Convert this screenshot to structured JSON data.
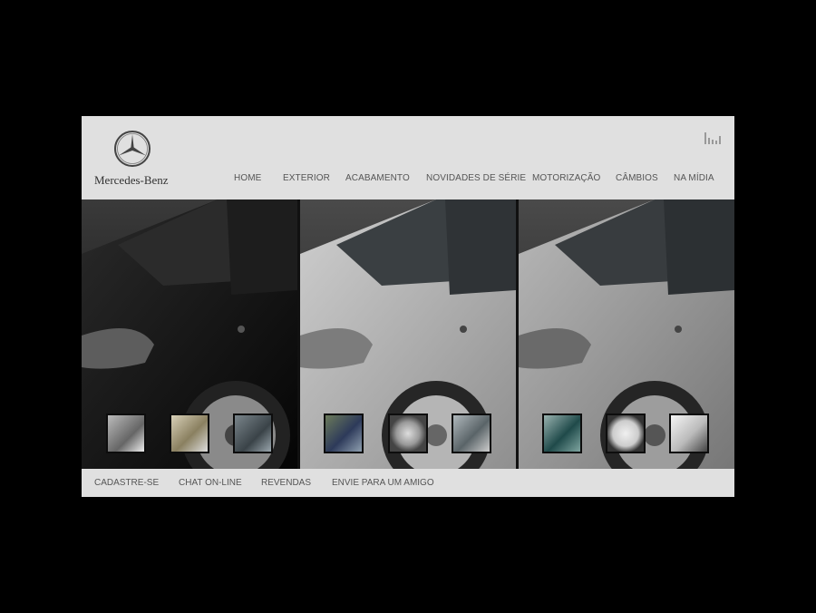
{
  "brand": {
    "name": "Mercedes-Benz",
    "logo_icon": "mercedes-star-icon"
  },
  "header": {
    "sound_icon": "sound-bars-icon"
  },
  "nav": {
    "items": [
      "HOME",
      "EXTERIOR",
      "ACABAMENTO",
      "NOVIDADES DE SÉRIE",
      "MOTORIZAÇÃO",
      "CÂMBIOS",
      "NA MÍDIA"
    ]
  },
  "panels": [
    {
      "name": "black-car-panel",
      "body_color": "#141414",
      "thumbs": [
        "wheel-detail",
        "instrument-cluster",
        "seat-detail"
      ]
    },
    {
      "name": "silver-car-panel",
      "body_color": "#a6a6a6",
      "thumbs": [
        "dashboard-display",
        "alloy-wheel",
        "gear-shift"
      ]
    },
    {
      "name": "grey-car-panel",
      "body_color": "#8a8a8a",
      "thumbs": [
        "door-interior",
        "mirror-detail",
        "side-mirror"
      ]
    }
  ],
  "footer": {
    "items": [
      "CADASTRE-SE",
      "CHAT ON-LINE",
      "REVENDAS",
      "ENVIE PARA UM AMIGO"
    ]
  },
  "colors": {
    "page_bg": "#000000",
    "site_bg": "#e0e0e0",
    "nav_text": "#555555"
  }
}
